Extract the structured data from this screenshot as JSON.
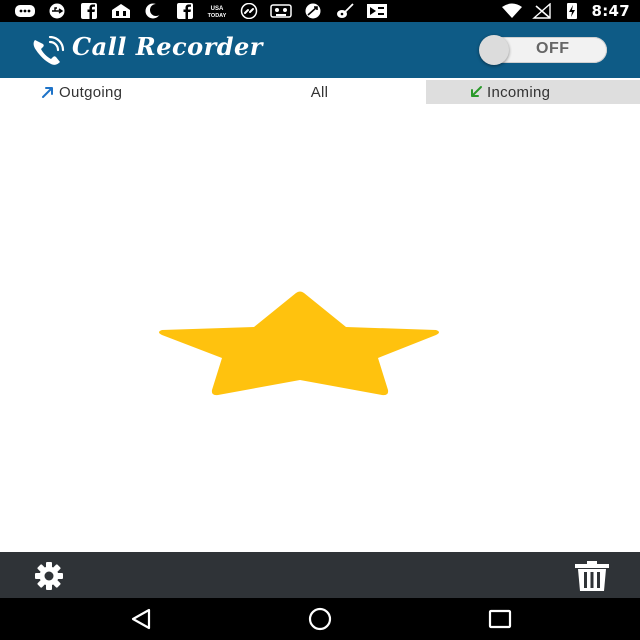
{
  "status_bar": {
    "time": "8:47",
    "left_icons": [
      "messaging-icon",
      "usb-icon",
      "facebook-icon",
      "home-network-icon",
      "moon-icon",
      "facebook-icon",
      "usa-today-icon",
      "link-icon",
      "cassette-icon",
      "satellite-icon",
      "guitar-icon",
      "media-icon"
    ],
    "usa_today_text": "USA TODAY",
    "right_icons": [
      "wifi-icon",
      "no-signal-icon",
      "battery-charging-icon"
    ]
  },
  "app_bar": {
    "title": "Call Recorder",
    "toggle_label": "OFF",
    "background_color": "#0e5b86"
  },
  "tabs": [
    {
      "label": "Outgoing",
      "icon": "arrow-up-right-icon",
      "icon_color": "#1e73c8"
    },
    {
      "label": "All",
      "icon": "",
      "icon_color": ""
    },
    {
      "label": "Incoming",
      "icon": "arrow-down-left-icon",
      "icon_color": "#2a9a2a",
      "selected": true
    }
  ],
  "content": {
    "icon": "star-icon",
    "star_color": "#ffc20e"
  },
  "bottom_bar": {
    "left_icon": "settings-gear-icon",
    "right_icon": "trash-icon"
  },
  "nav_bar": {
    "buttons": [
      "back-icon",
      "home-icon",
      "recent-apps-icon"
    ]
  }
}
